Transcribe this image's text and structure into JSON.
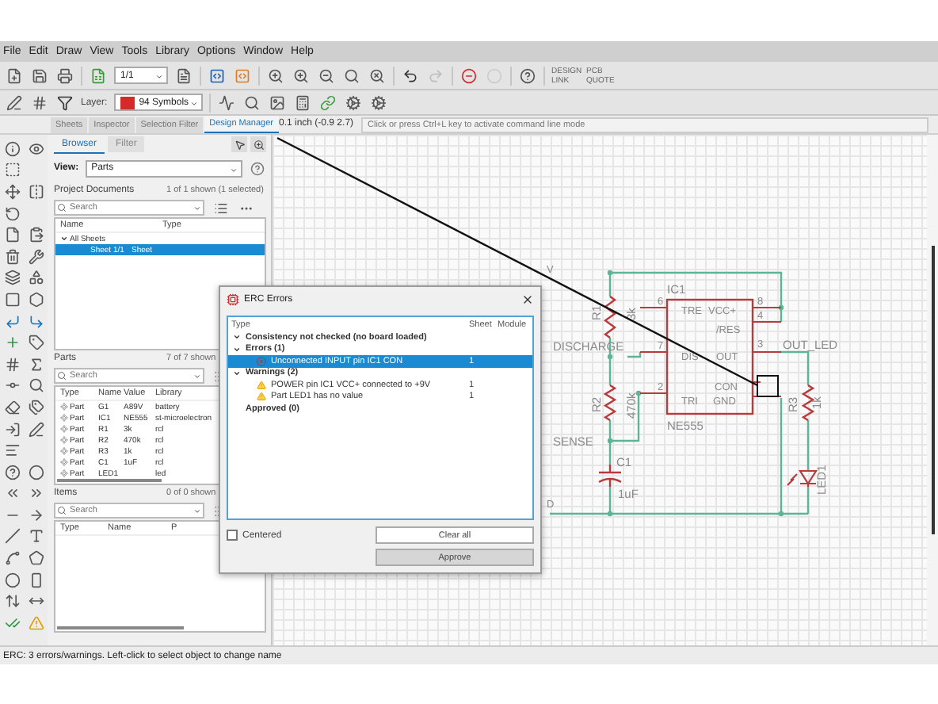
{
  "menu": [
    "File",
    "Edit",
    "Draw",
    "View",
    "Tools",
    "Library",
    "Options",
    "Window",
    "Help"
  ],
  "toolbar": {
    "zoom": "1/1",
    "layer_label": "Layer:",
    "layer": "94 Symbols",
    "extras": [
      "DESIGN LINK",
      "PCB QUOTE"
    ]
  },
  "panel_tabs": [
    {
      "label": "Sheets",
      "selected": false
    },
    {
      "label": "Inspector",
      "selected": false
    },
    {
      "label": "Selection Filter",
      "selected": false
    },
    {
      "label": "Design Manager",
      "selected": true
    }
  ],
  "coordinates": "0.1 inch (-0.9 2.7)",
  "command_line": {
    "placeholder": "Click or press Ctrl+L key to activate command line mode"
  },
  "sub_tabs": [
    {
      "label": "Browser",
      "selected": true
    },
    {
      "label": "Filter",
      "selected": false
    }
  ],
  "view": {
    "label": "View:",
    "value": "Parts"
  },
  "project_documents": {
    "title": "Project Documents",
    "count": "1 of 1 shown (1 selected)",
    "search": {
      "placeholder": "Search"
    },
    "columns": [
      "Name",
      "Type"
    ],
    "tree": [
      {
        "name": "All Sheets",
        "expanded": true,
        "selected": false,
        "children": [
          {
            "name": "Sheet 1/1",
            "type": "Sheet",
            "selected": true
          }
        ]
      }
    ]
  },
  "parts": {
    "title": "Parts",
    "count": "7 of 7 shown",
    "search": {
      "placeholder": "Search"
    },
    "columns": [
      "Type",
      "Name",
      "Value",
      "Library"
    ],
    "rows": [
      {
        "type": "Part",
        "name": "G1",
        "value": "A89V",
        "library": "battery"
      },
      {
        "type": "Part",
        "name": "IC1",
        "value": "NE555",
        "library": "st-microelectron"
      },
      {
        "type": "Part",
        "name": "R1",
        "value": "3k",
        "library": "rcl"
      },
      {
        "type": "Part",
        "name": "R2",
        "value": "470k",
        "library": "rcl"
      },
      {
        "type": "Part",
        "name": "R3",
        "value": "1k",
        "library": "rcl"
      },
      {
        "type": "Part",
        "name": "C1",
        "value": "1uF",
        "library": "rcl"
      },
      {
        "type": "Part",
        "name": "LED1",
        "library": "led"
      }
    ]
  },
  "items": {
    "title": "Items",
    "count": "0 of 0 shown",
    "search": {
      "placeholder": "Search"
    },
    "columns": [
      "Type",
      "Name",
      "P"
    ]
  },
  "schematic": {
    "labels": [
      "V",
      "IC1",
      "6",
      "8",
      "TRE",
      "VCC+",
      "R1",
      "3k",
      "4",
      "/RES",
      "7",
      "3",
      "OUT_LED",
      "DIS",
      "OUT",
      "DISCHARGE",
      "2",
      "CON",
      "TRI",
      "GND",
      "R2",
      "470k",
      "R3",
      "1k",
      "NE555",
      "SENSE",
      "C1",
      "LED1",
      "1uF",
      "D"
    ]
  },
  "dialog": {
    "title": "ERC Errors",
    "columns": [
      "Type",
      "Sheet",
      "Module"
    ],
    "groups": [
      {
        "label": "Consistency not checked (no board loaded)",
        "expanded": true
      },
      {
        "label": "Errors (1)",
        "expanded": true,
        "children": [
          {
            "kind": "error",
            "text": "Unconnected INPUT pin IC1 CON",
            "sheet": "1",
            "selected": true
          }
        ]
      },
      {
        "label": "Warnings (2)",
        "expanded": true,
        "children": [
          {
            "kind": "warning",
            "text": "POWER pin IC1 VCC+ connected to +9V",
            "sheet": "1",
            "selected": false
          },
          {
            "kind": "warning",
            "text": "Part LED1 has no value",
            "sheet": "1",
            "selected": false
          }
        ]
      },
      {
        "label": "Approved (0)"
      }
    ],
    "centered": {
      "label": "Centered",
      "checked": false
    },
    "buttons": [
      {
        "label": "Clear all",
        "highlighted": false
      },
      {
        "label": "Approve",
        "highlighted": true
      }
    ]
  },
  "status_bar": "ERC: 3 errors/warnings. Left-click to select object to change name"
}
